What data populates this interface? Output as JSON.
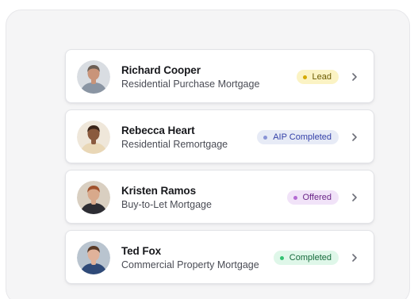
{
  "deals": [
    {
      "name": "Richard Cooper",
      "product": "Residential Purchase Mortgage",
      "status": "Lead",
      "status_bg": "#fbf3c4",
      "status_fg": "#6b5a00",
      "status_dot": "#d4a900",
      "avatar_skin": "#c99479",
      "avatar_hair": "#6b5e54",
      "avatar_bg": "#d9dde2",
      "avatar_shirt": "#8a95a3"
    },
    {
      "name": "Rebecca Heart",
      "product": "Residential Remortgage",
      "status": "AIP Completed",
      "status_bg": "#e7ebf6",
      "status_fg": "#3440a8",
      "status_dot": "#8a94d6",
      "avatar_skin": "#8a5a3e",
      "avatar_hair": "#3a2418",
      "avatar_bg": "#efe7da",
      "avatar_shirt": "#e9d7b6"
    },
    {
      "name": "Kristen Ramos",
      "product": "Buy-to-Let Mortgage",
      "status": "Offered",
      "status_bg": "#f1e3f8",
      "status_fg": "#6a2487",
      "status_dot": "#b46bd3",
      "avatar_skin": "#d8a98b",
      "avatar_hair": "#a0522d",
      "avatar_bg": "#d9cfc1",
      "avatar_shirt": "#2d2d33"
    },
    {
      "name": "Ted Fox",
      "product": "Commercial Property Mortgage",
      "status": "Completed",
      "status_bg": "#dff7e9",
      "status_fg": "#166b3c",
      "status_dot": "#33c272",
      "avatar_skin": "#e0b29a",
      "avatar_hair": "#5a3a26",
      "avatar_bg": "#b9c4cf",
      "avatar_shirt": "#2f4a78"
    }
  ]
}
